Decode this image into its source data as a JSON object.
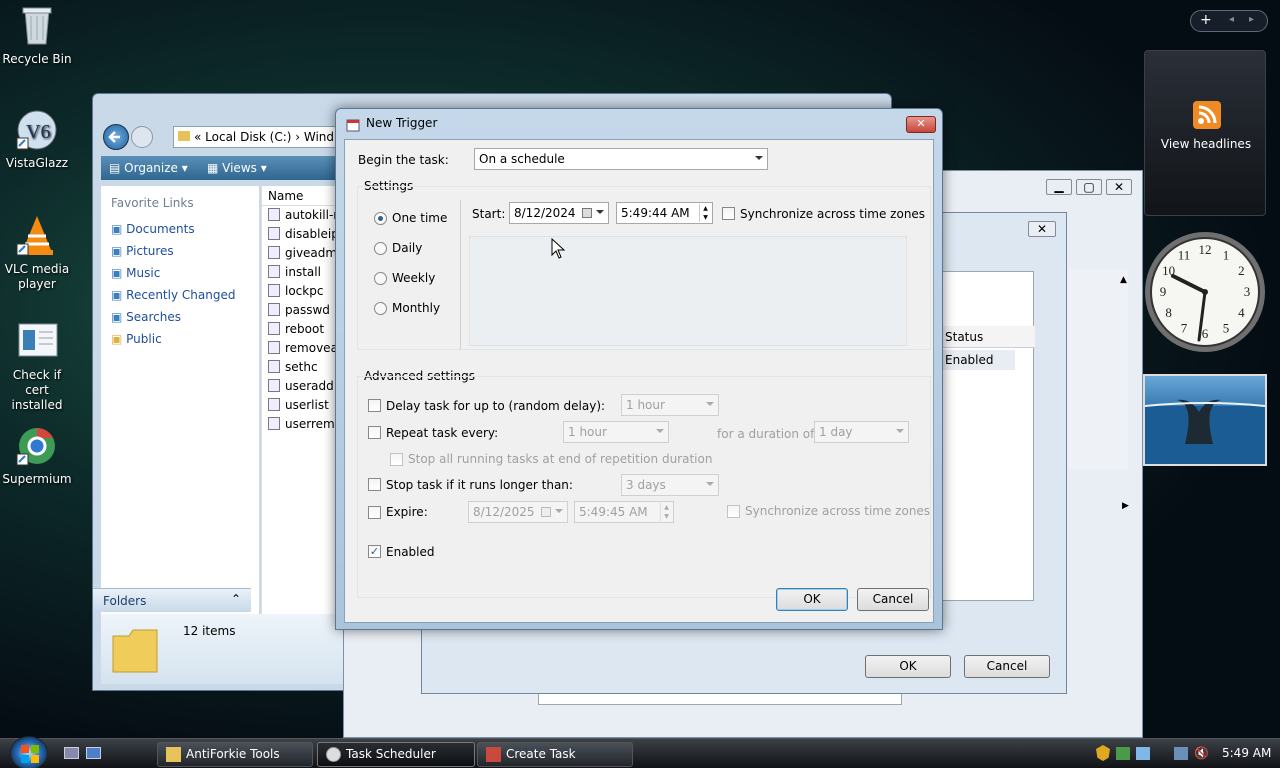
{
  "desktop": {
    "icons": [
      {
        "label": "Recycle Bin"
      },
      {
        "label": "VistaGlazz"
      },
      {
        "label": "VLC media player"
      },
      {
        "label": "Check if cert installed"
      },
      {
        "label": "Supermium"
      }
    ]
  },
  "explorer": {
    "breadcrumb": "«  Local Disk (C:)  ›  Wind",
    "toolbar": {
      "organize": "Organize",
      "views": "Views"
    },
    "favorite_links_heading": "Favorite Links",
    "favorite_links": [
      "Documents",
      "Pictures",
      "Music",
      "Recently Changed",
      "Searches",
      "Public"
    ],
    "column_name": "Name",
    "files": [
      "autokill-r",
      "disableip",
      "giveadmi",
      "install",
      "lockpc",
      "passwd",
      "reboot",
      "removead",
      "sethc",
      "useradd",
      "userlist",
      "userremo"
    ],
    "folders_label": "Folders",
    "item_count": "12 items"
  },
  "scheduler": {
    "status_header": "Status",
    "status_value": "Enabled",
    "ok": "OK",
    "cancel": "Cancel"
  },
  "dialog": {
    "title": "New Trigger",
    "begin_label": "Begin the task:",
    "begin_value": "On a schedule",
    "settings_heading": "Settings",
    "schedule_options": [
      "One time",
      "Daily",
      "Weekly",
      "Monthly"
    ],
    "selected_option": "One time",
    "start_label": "Start:",
    "start_date": "8/12/2024",
    "start_time": "5:49:44 AM",
    "sync_label": "Synchronize across time zones",
    "advanced_heading": "Advanced settings",
    "delay_label": "Delay task for up to (random delay):",
    "delay_value": "1 hour",
    "repeat_label": "Repeat task every:",
    "repeat_value": "1 hour",
    "duration_label": "for a duration of:",
    "duration_value": "1 day",
    "stop_running_label": "Stop all running tasks at end of repetition duration",
    "stop_longer_label": "Stop task if it runs longer than:",
    "stop_longer_value": "3 days",
    "expire_label": "Expire:",
    "expire_date": "8/12/2025",
    "expire_time": "5:49:45 AM",
    "expire_sync_label": "Synchronize across time zones",
    "enabled_label": "Enabled",
    "enabled_checked": true,
    "ok": "OK",
    "cancel": "Cancel"
  },
  "gadgets": {
    "feed_label": "View headlines",
    "clock_numbers": [
      "12",
      "1",
      "2",
      "3",
      "4",
      "5",
      "6",
      "7",
      "8",
      "9",
      "10",
      "11"
    ],
    "sidebar_add": "+"
  },
  "taskbar": {
    "buttons": [
      {
        "label": "AntiForkie Tools"
      },
      {
        "label": "Task Scheduler"
      },
      {
        "label": "Create Task"
      }
    ],
    "clock": "5:49 AM"
  },
  "colors": {
    "accent": "#2c628b",
    "titlebar": "#b8cfe4",
    "close_red": "#c7473a"
  }
}
